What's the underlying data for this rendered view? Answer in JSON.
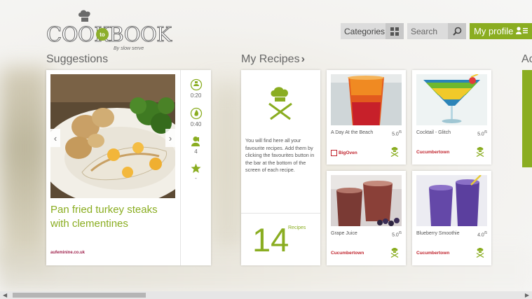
{
  "app": {
    "logo_text": "COOKBOOK",
    "logo_to": "to",
    "logo_by": "By slow serve"
  },
  "header": {
    "categories_label": "Categories",
    "search_placeholder": "Search",
    "profile_label": "My profile"
  },
  "sections": {
    "suggestions": "Suggestions",
    "my_recipes": "My Recipes",
    "next": "Ac"
  },
  "suggestion": {
    "title": "Pan fried turkey steaks with clementines",
    "source": "aufeminine.co.uk",
    "prep_time": "0:20",
    "cook_time": "0:40",
    "servings": "4",
    "rating": "-"
  },
  "my_recipes": {
    "intro_text": "You will find here all your favourite recipes. Add them by clicking the favourites button in the bar at the bottom of the screen of each recipe.",
    "count": "14",
    "count_label": "Recipes"
  },
  "recipes": [
    {
      "name": "A Day At the Beach",
      "rating": "5.0",
      "rating_max": "/5",
      "source": "BigOven"
    },
    {
      "name": "Cocktail - Glitch",
      "rating": "5.0",
      "rating_max": "/5",
      "source": "Cucumbertown"
    },
    {
      "name": "Grape Juice",
      "rating": "5.0",
      "rating_max": "/5",
      "source": "Cucumbertown"
    },
    {
      "name": "Blueberry Smoothie",
      "rating": "4.0",
      "rating_max": "/5",
      "source": "Cucumbertown"
    }
  ],
  "colors": {
    "accent": "#8aad21",
    "source_red": "#c0242d"
  }
}
